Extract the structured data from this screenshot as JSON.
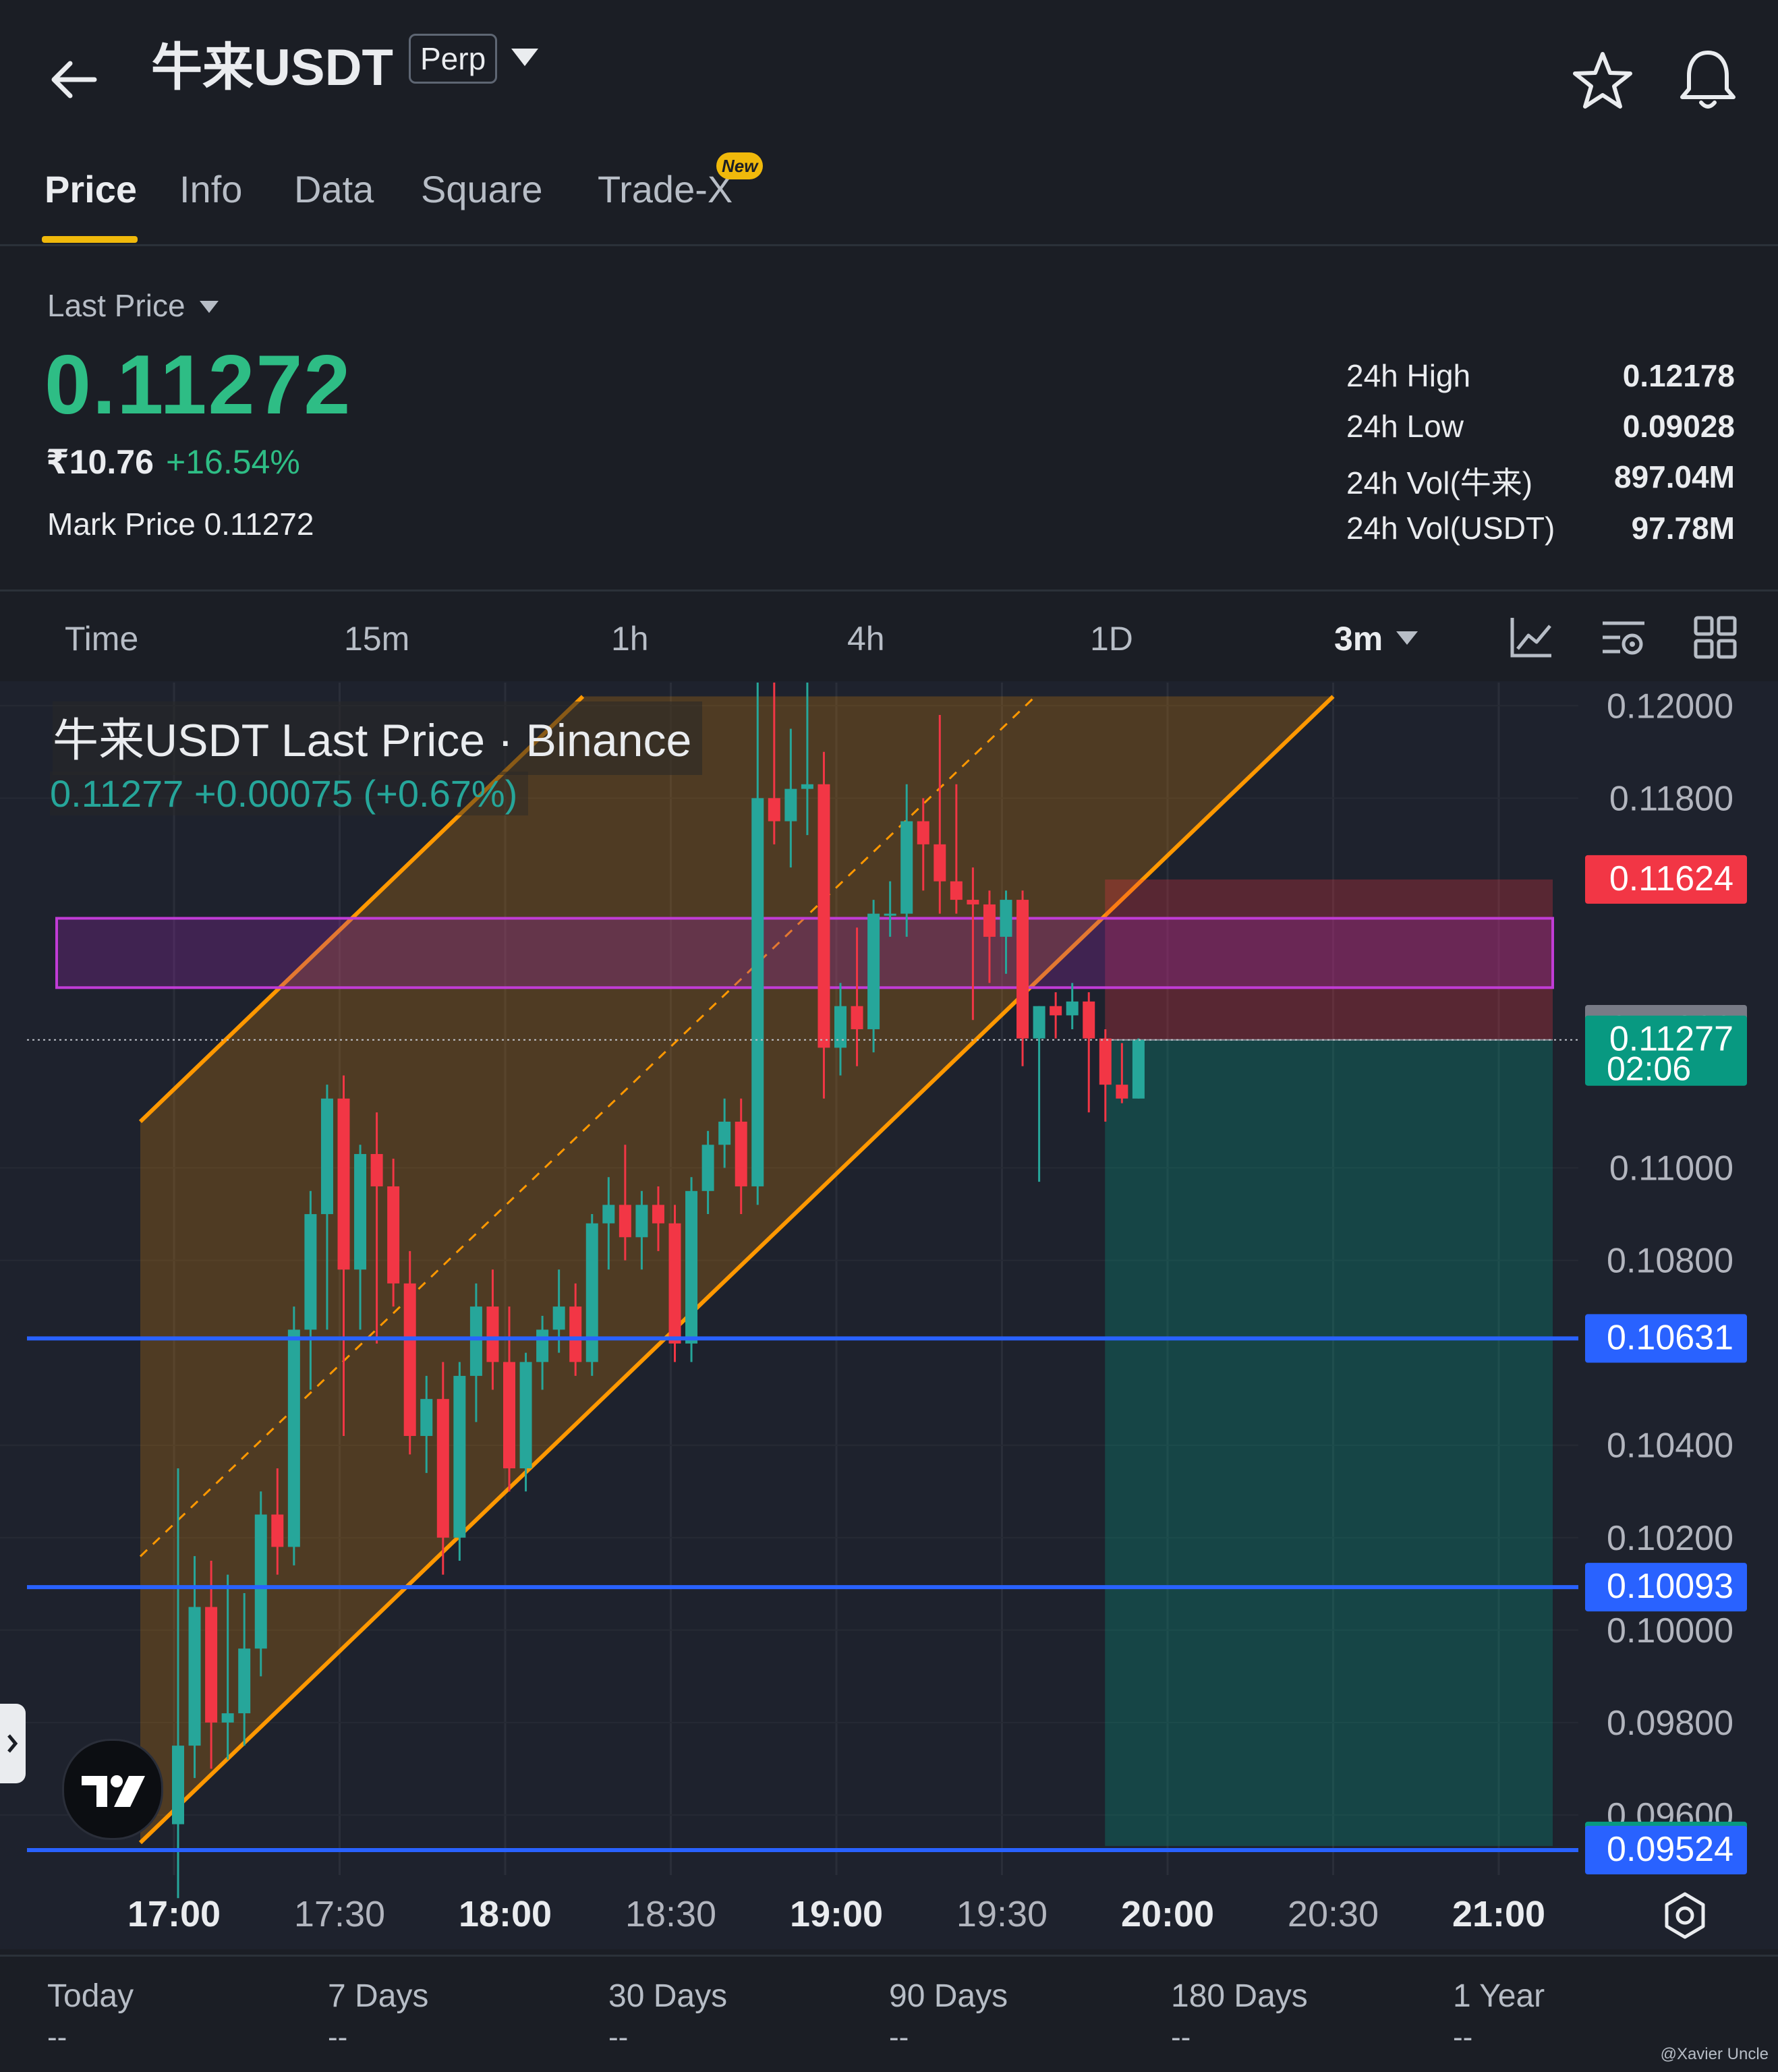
{
  "header": {
    "symbol": "牛来USDT",
    "contract_badge": "Perp"
  },
  "tabs": [
    {
      "label": "Price",
      "active": true
    },
    {
      "label": "Info"
    },
    {
      "label": "Data"
    },
    {
      "label": "Square"
    },
    {
      "label": "Trade-X",
      "badge": "New"
    }
  ],
  "price": {
    "label": "Last Price",
    "value": "0.11272",
    "fiat": "₹10.76",
    "change_pct": "+16.54%",
    "mark_price": "Mark Price 0.11272"
  },
  "stats": [
    {
      "label": "24h High",
      "value": "0.12178"
    },
    {
      "label": "24h Low",
      "value": "0.09028"
    },
    {
      "label": "24h Vol(牛来)",
      "value": "897.04M"
    },
    {
      "label": "24h Vol(USDT)",
      "value": "97.78M"
    }
  ],
  "intervals": [
    {
      "label": "Time"
    },
    {
      "label": "15m"
    },
    {
      "label": "1h"
    },
    {
      "label": "4h"
    },
    {
      "label": "1D"
    },
    {
      "label": "3m",
      "active": true
    }
  ],
  "colors": {
    "up": "#26a69a",
    "down": "#f23645",
    "accent": "#f0b90b",
    "price_up_text": "#2ebd85",
    "level_line": "#2962ff",
    "channel": "#ff9800",
    "zone": "#9c27b0"
  },
  "chart_data": {
    "type": "candlestick",
    "title": "牛来USDT Last Price · Binance",
    "legend_values": "0.11277  +0.00075 (+0.67%)",
    "interval": "3m",
    "ylim": [
      0.0947,
      0.1205
    ],
    "y_ticks": [
      "0.12000",
      "0.11800",
      "0.11000",
      "0.10800",
      "0.10400",
      "0.10200",
      "0.10000",
      "0.09800",
      "0.09600"
    ],
    "x_ticks": [
      {
        "label": "17:00",
        "bold": true
      },
      {
        "label": "17:30"
      },
      {
        "label": "18:00",
        "bold": true
      },
      {
        "label": "18:30"
      },
      {
        "label": "19:00",
        "bold": true
      },
      {
        "label": "19:30"
      },
      {
        "label": "20:00",
        "bold": true
      },
      {
        "label": "20:30"
      },
      {
        "label": "21:00",
        "bold": true
      }
    ],
    "x_start": "17:00",
    "x_end": "21:00",
    "candles": [
      {
        "t": "17:00",
        "o": 0.0958,
        "h": 0.1035,
        "l": 0.0942,
        "c": 0.0975
      },
      {
        "t": "17:03",
        "o": 0.0975,
        "h": 0.1016,
        "l": 0.0968,
        "c": 0.1005
      },
      {
        "t": "17:06",
        "o": 0.1005,
        "h": 0.1015,
        "l": 0.097,
        "c": 0.098
      },
      {
        "t": "17:09",
        "o": 0.098,
        "h": 0.1012,
        "l": 0.0972,
        "c": 0.0982
      },
      {
        "t": "17:12",
        "o": 0.0982,
        "h": 0.1008,
        "l": 0.0975,
        "c": 0.0996
      },
      {
        "t": "17:15",
        "o": 0.0996,
        "h": 0.103,
        "l": 0.099,
        "c": 0.1025
      },
      {
        "t": "17:18",
        "o": 0.1025,
        "h": 0.1035,
        "l": 0.1012,
        "c": 0.1018
      },
      {
        "t": "17:21",
        "o": 0.1018,
        "h": 0.107,
        "l": 0.1014,
        "c": 0.1065
      },
      {
        "t": "17:24",
        "o": 0.1065,
        "h": 0.1095,
        "l": 0.1052,
        "c": 0.109
      },
      {
        "t": "17:27",
        "o": 0.109,
        "h": 0.1118,
        "l": 0.1065,
        "c": 0.1115
      },
      {
        "t": "17:30",
        "o": 0.1115,
        "h": 0.112,
        "l": 0.1042,
        "c": 0.1078
      },
      {
        "t": "17:33",
        "o": 0.1078,
        "h": 0.1105,
        "l": 0.1065,
        "c": 0.1103
      },
      {
        "t": "17:36",
        "o": 0.1103,
        "h": 0.1112,
        "l": 0.1062,
        "c": 0.1096
      },
      {
        "t": "17:39",
        "o": 0.1096,
        "h": 0.1102,
        "l": 0.107,
        "c": 0.1075
      },
      {
        "t": "17:42",
        "o": 0.1075,
        "h": 0.1082,
        "l": 0.1038,
        "c": 0.1042
      },
      {
        "t": "17:45",
        "o": 0.1042,
        "h": 0.1055,
        "l": 0.1034,
        "c": 0.105
      },
      {
        "t": "17:48",
        "o": 0.105,
        "h": 0.1058,
        "l": 0.1012,
        "c": 0.102
      },
      {
        "t": "17:51",
        "o": 0.102,
        "h": 0.1058,
        "l": 0.1015,
        "c": 0.1055
      },
      {
        "t": "17:54",
        "o": 0.1055,
        "h": 0.1075,
        "l": 0.1045,
        "c": 0.107
      },
      {
        "t": "17:57",
        "o": 0.107,
        "h": 0.1078,
        "l": 0.1052,
        "c": 0.1058
      },
      {
        "t": "18:00",
        "o": 0.1058,
        "h": 0.107,
        "l": 0.103,
        "c": 0.1035
      },
      {
        "t": "18:03",
        "o": 0.1035,
        "h": 0.106,
        "l": 0.103,
        "c": 0.1058
      },
      {
        "t": "18:06",
        "o": 0.1058,
        "h": 0.1068,
        "l": 0.1052,
        "c": 0.1065
      },
      {
        "t": "18:09",
        "o": 0.1065,
        "h": 0.1078,
        "l": 0.106,
        "c": 0.107
      },
      {
        "t": "18:12",
        "o": 0.107,
        "h": 0.1075,
        "l": 0.1055,
        "c": 0.1058
      },
      {
        "t": "18:15",
        "o": 0.1058,
        "h": 0.109,
        "l": 0.1055,
        "c": 0.1088
      },
      {
        "t": "18:18",
        "o": 0.1088,
        "h": 0.1098,
        "l": 0.1078,
        "c": 0.1092
      },
      {
        "t": "18:21",
        "o": 0.1092,
        "h": 0.1105,
        "l": 0.108,
        "c": 0.1085
      },
      {
        "t": "18:24",
        "o": 0.1085,
        "h": 0.1095,
        "l": 0.1078,
        "c": 0.1092
      },
      {
        "t": "18:27",
        "o": 0.1092,
        "h": 0.1096,
        "l": 0.1082,
        "c": 0.1088
      },
      {
        "t": "18:30",
        "o": 0.1088,
        "h": 0.1092,
        "l": 0.1058,
        "c": 0.1062
      },
      {
        "t": "18:33",
        "o": 0.1062,
        "h": 0.1098,
        "l": 0.1058,
        "c": 0.1095
      },
      {
        "t": "18:36",
        "o": 0.1095,
        "h": 0.1108,
        "l": 0.109,
        "c": 0.1105
      },
      {
        "t": "18:39",
        "o": 0.1105,
        "h": 0.1115,
        "l": 0.11,
        "c": 0.111
      },
      {
        "t": "18:42",
        "o": 0.111,
        "h": 0.1115,
        "l": 0.109,
        "c": 0.1096
      },
      {
        "t": "18:45",
        "o": 0.1096,
        "h": 0.1205,
        "l": 0.1092,
        "c": 0.118
      },
      {
        "t": "18:48",
        "o": 0.118,
        "h": 0.1205,
        "l": 0.117,
        "c": 0.1175
      },
      {
        "t": "18:51",
        "o": 0.1175,
        "h": 0.1195,
        "l": 0.1165,
        "c": 0.1182
      },
      {
        "t": "18:54",
        "o": 0.1182,
        "h": 0.1205,
        "l": 0.1172,
        "c": 0.1183
      },
      {
        "t": "18:57",
        "o": 0.1183,
        "h": 0.119,
        "l": 0.1115,
        "c": 0.1126
      },
      {
        "t": "19:00",
        "o": 0.1126,
        "h": 0.114,
        "l": 0.112,
        "c": 0.1135
      },
      {
        "t": "19:03",
        "o": 0.1135,
        "h": 0.1152,
        "l": 0.1122,
        "c": 0.113
      },
      {
        "t": "19:06",
        "o": 0.113,
        "h": 0.1158,
        "l": 0.1125,
        "c": 0.1155
      },
      {
        "t": "19:09",
        "o": 0.1155,
        "h": 0.1162,
        "l": 0.115,
        "c": 0.1155
      },
      {
        "t": "19:12",
        "o": 0.1155,
        "h": 0.1183,
        "l": 0.115,
        "c": 0.1175
      },
      {
        "t": "19:15",
        "o": 0.1175,
        "h": 0.118,
        "l": 0.116,
        "c": 0.117
      },
      {
        "t": "19:18",
        "o": 0.117,
        "h": 0.1198,
        "l": 0.1155,
        "c": 0.1162
      },
      {
        "t": "19:21",
        "o": 0.1162,
        "h": 0.1183,
        "l": 0.1155,
        "c": 0.1158
      },
      {
        "t": "19:24",
        "o": 0.1158,
        "h": 0.1165,
        "l": 0.1132,
        "c": 0.1157
      },
      {
        "t": "19:27",
        "o": 0.1157,
        "h": 0.116,
        "l": 0.114,
        "c": 0.115
      },
      {
        "t": "19:30",
        "o": 0.115,
        "h": 0.116,
        "l": 0.1142,
        "c": 0.1158
      },
      {
        "t": "19:33",
        "o": 0.1158,
        "h": 0.116,
        "l": 0.1122,
        "c": 0.1128
      },
      {
        "t": "19:36",
        "o": 0.1128,
        "h": 0.1135,
        "l": 0.1097,
        "c": 0.1135
      },
      {
        "t": "19:39",
        "o": 0.1135,
        "h": 0.1138,
        "l": 0.1128,
        "c": 0.1133
      },
      {
        "t": "19:42",
        "o": 0.1133,
        "h": 0.114,
        "l": 0.113,
        "c": 0.1136
      },
      {
        "t": "19:45",
        "o": 0.1136,
        "h": 0.1138,
        "l": 0.1112,
        "c": 0.1128
      },
      {
        "t": "19:48",
        "o": 0.1128,
        "h": 0.113,
        "l": 0.111,
        "c": 0.1118
      },
      {
        "t": "19:51",
        "o": 0.1118,
        "h": 0.1127,
        "l": 0.1114,
        "c": 0.1115
      },
      {
        "t": "19:54",
        "o": 0.1115,
        "h": 0.1128,
        "l": 0.1115,
        "c": 0.11277
      }
    ],
    "channel": {
      "from": [
        "17:00",
        0.0954
      ],
      "to": [
        "20:30",
        0.1202
      ],
      "upper_from": [
        "17:00",
        0.111
      ],
      "upper_to": [
        "18:57",
        0.1202
      ]
    },
    "resistance_zone": [
      0.1139,
      0.1154
    ],
    "short_position": {
      "from": "19:45",
      "to": "21:00",
      "entry": 0.11277,
      "stop": 0.11624,
      "target": 0.09533
    },
    "hlines": [
      0.10631,
      0.10093,
      0.09524
    ],
    "price_tags": [
      {
        "value": "0.11624",
        "bg": "#f23645"
      },
      {
        "value": "0.11300",
        "bg": "#787b86"
      },
      {
        "value": "0.11277",
        "sub": "02:06",
        "bg": "#089981"
      },
      {
        "value": "0.10631",
        "bg": "#2962ff"
      },
      {
        "value": "0.10093",
        "bg": "#2962ff"
      },
      {
        "value": "0.09533",
        "bg": "#089981"
      },
      {
        "value": "0.09524",
        "bg": "#2962ff"
      }
    ]
  },
  "bottom_stats": [
    {
      "label": "Today",
      "value": "--"
    },
    {
      "label": "7 Days",
      "value": "--"
    },
    {
      "label": "30 Days",
      "value": "--"
    },
    {
      "label": "90 Days",
      "value": "--"
    },
    {
      "label": "180 Days",
      "value": "--"
    },
    {
      "label": "1 Year",
      "value": "--"
    }
  ],
  "watermark": "@Xavier Uncle",
  "icons": [
    "back-arrow-icon",
    "dropdown-caret-icon",
    "star-icon",
    "bell-icon",
    "indicator-icon",
    "chart-settings-icon",
    "layout-grid-icon",
    "tradingview-logo-icon",
    "chart-gear-icon"
  ]
}
